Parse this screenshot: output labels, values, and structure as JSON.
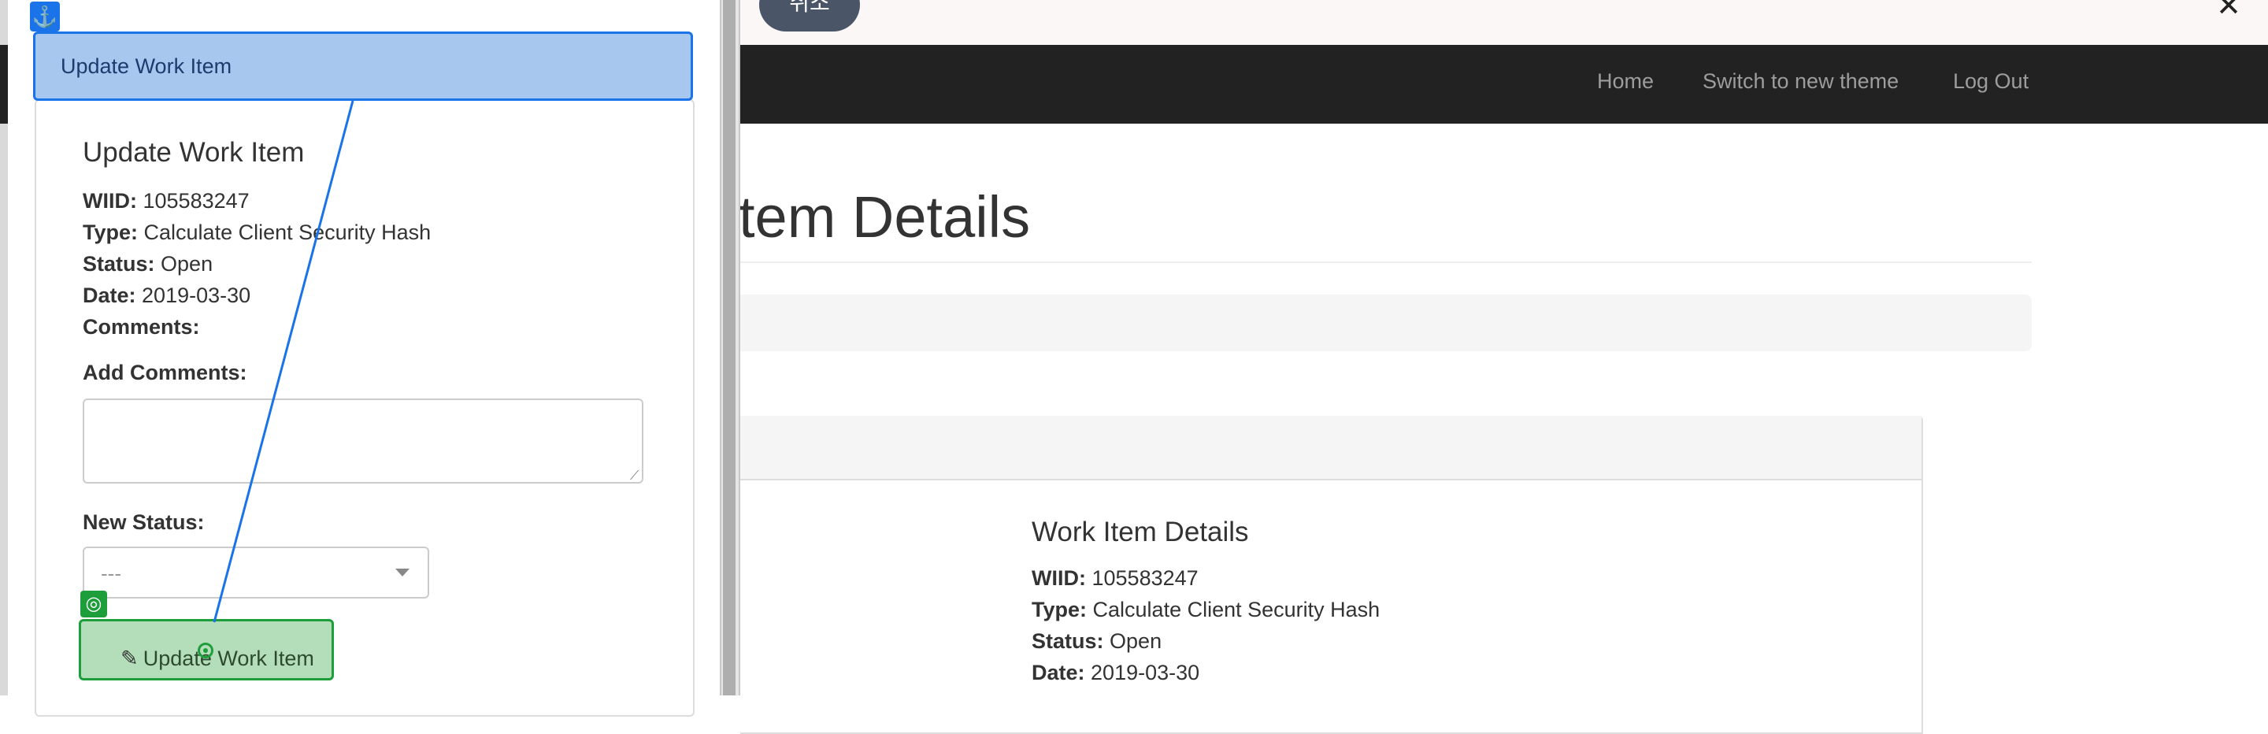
{
  "topbar": {
    "cancel_label": "취소",
    "close_symbol": "✕"
  },
  "navbar": {
    "links": [
      "Home",
      "Switch to new theme",
      "Log Out"
    ]
  },
  "page": {
    "heading": "tem Details"
  },
  "details": {
    "title": "Work Item Details",
    "wiid_label": "WIID:",
    "wiid": "105583247",
    "type_label": "Type:",
    "type": "Calculate Client Security Hash",
    "status_label": "Status:",
    "status": "Open",
    "date_label": "Date:",
    "date": "2019-03-30"
  },
  "modal": {
    "header": "Update Work Item",
    "anchor_icon": "anchor-icon",
    "title": "Update Work Item",
    "wiid_label": "WIID:",
    "wiid": "105583247",
    "type_label": "Type:",
    "type": "Calculate Client Security Hash",
    "status_label": "Status:",
    "status": "Open",
    "date_label": "Date:",
    "date": "2019-03-30",
    "comments_label": "Comments:",
    "add_comments_label": "Add Comments:",
    "comments_value": "",
    "new_status_label": "New Status:",
    "new_status_value": "---",
    "target_icon": "target-icon",
    "update_button": "Update Work Item",
    "pencil_icon": "pencil-icon"
  },
  "colors": {
    "highlight_blue": "#1a73e8",
    "highlight_green": "#1e9e3a",
    "navbar": "#222222"
  }
}
